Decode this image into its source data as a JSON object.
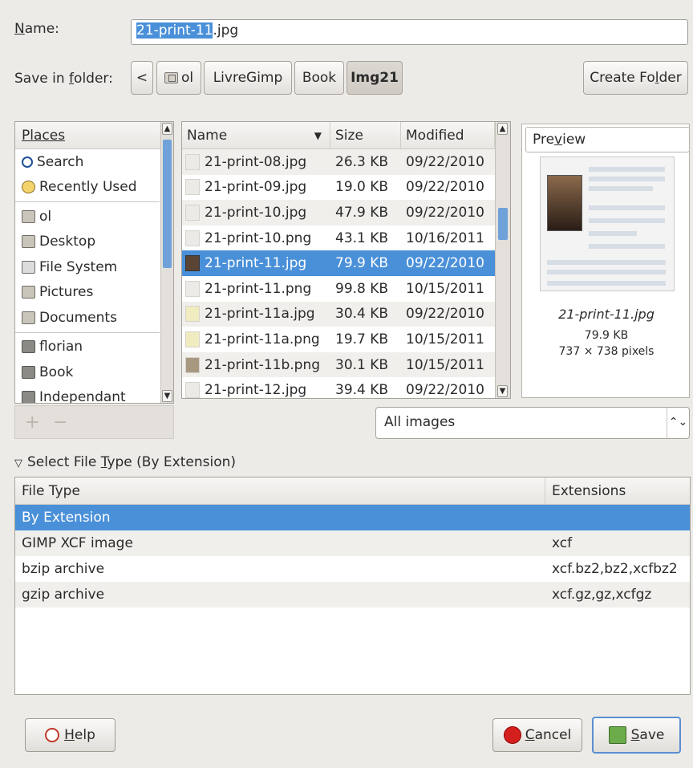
{
  "name": {
    "label_prefix": "",
    "label_key": "N",
    "label_rest": "ame:",
    "value_selected": "21-print-11",
    "value_rest": ".jpg"
  },
  "folder": {
    "label_a": "Save in ",
    "label_key": "f",
    "label_b": "older:",
    "back": "<",
    "crumbs": [
      "ol",
      "LivreGimp",
      "Book",
      "Img21"
    ],
    "create_a": "Create Fo",
    "create_key": "l",
    "create_b": "der"
  },
  "places": {
    "header": "Places",
    "items": [
      {
        "label": "Search",
        "icon": "search-icon"
      },
      {
        "label": "Recently Used",
        "icon": "recent-icon"
      },
      {
        "label": "ol",
        "icon": "home-folder-icon"
      },
      {
        "label": "Desktop",
        "icon": "desktop-icon"
      },
      {
        "label": "File System",
        "icon": "drive-icon"
      },
      {
        "label": "Pictures",
        "icon": "pictures-folder-icon"
      },
      {
        "label": "Documents",
        "icon": "documents-folder-icon"
      },
      {
        "label": "florian",
        "icon": "folder-icon"
      },
      {
        "label": "Book",
        "icon": "folder-icon"
      },
      {
        "label": "Independant",
        "icon": "folder-icon"
      }
    ],
    "add": "+",
    "remove": "−"
  },
  "files": {
    "headers": {
      "name": "Name",
      "size": "Size",
      "modified": "Modified"
    },
    "rows": [
      {
        "name": "21-print-08.jpg",
        "size": "26.3 KB",
        "modified": "09/22/2010"
      },
      {
        "name": "21-print-09.jpg",
        "size": "19.0 KB",
        "modified": "09/22/2010"
      },
      {
        "name": "21-print-10.jpg",
        "size": "47.9 KB",
        "modified": "09/22/2010"
      },
      {
        "name": "21-print-10.png",
        "size": "43.1 KB",
        "modified": "10/16/2011"
      },
      {
        "name": "21-print-11.jpg",
        "size": "79.9 KB",
        "modified": "09/22/2010"
      },
      {
        "name": "21-print-11.png",
        "size": "99.8 KB",
        "modified": "10/15/2011"
      },
      {
        "name": "21-print-11a.jpg",
        "size": "30.4 KB",
        "modified": "09/22/2010"
      },
      {
        "name": "21-print-11a.png",
        "size": "19.7 KB",
        "modified": "10/15/2011"
      },
      {
        "name": "21-print-11b.png",
        "size": "30.1 KB",
        "modified": "10/15/2011"
      },
      {
        "name": "21-print-12.jpg",
        "size": "39.4 KB",
        "modified": "09/22/2010"
      }
    ]
  },
  "preview": {
    "title_a": "Pre",
    "title_key": "v",
    "title_b": "iew",
    "filename": "21-print-11.jpg",
    "size": "79.9 KB",
    "dims": "737 × 738 pixels"
  },
  "filter": {
    "value": "All images",
    "arrows": "⌃⌄"
  },
  "file_type": {
    "expander_a": "Select File ",
    "expander_key": "T",
    "expander_b": "ype (By Extension)",
    "headers": {
      "type": "File Type",
      "ext": "Extensions"
    },
    "rows": [
      {
        "type": "By Extension",
        "ext": ""
      },
      {
        "type": "GIMP XCF image",
        "ext": "xcf"
      },
      {
        "type": "bzip archive",
        "ext": "xcf.bz2,bz2,xcfbz2"
      },
      {
        "type": "gzip archive",
        "ext": "xcf.gz,gz,xcfgz"
      }
    ]
  },
  "buttons": {
    "help_key": "H",
    "help_rest": "elp",
    "cancel_key": "C",
    "cancel_rest": "ancel",
    "save_key": "S",
    "save_rest": "ave"
  },
  "colors": {
    "selection": "#4a90d9",
    "background": "#edebe8",
    "scroll_thumb": "#6ea2d8"
  }
}
